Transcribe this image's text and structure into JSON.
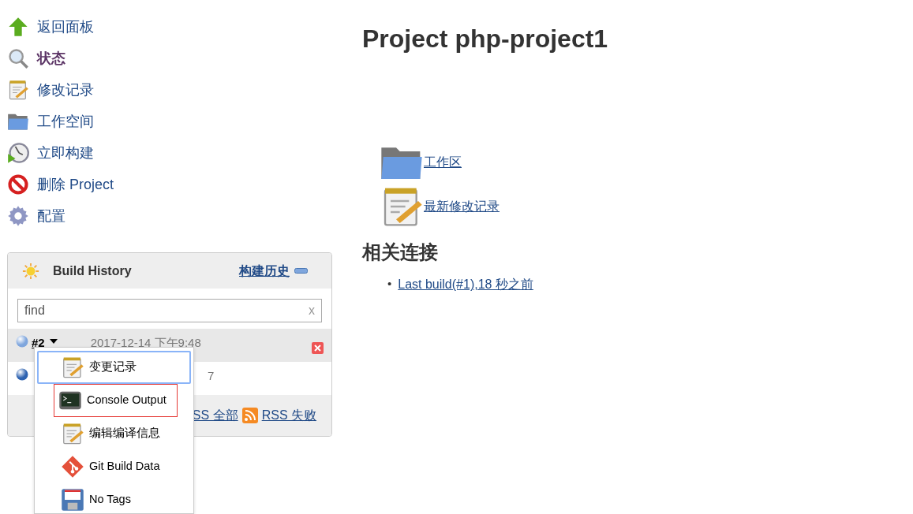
{
  "sidebar": {
    "items": [
      {
        "label": "返回面板",
        "kind": "up",
        "selected": false
      },
      {
        "label": "状态",
        "kind": "search",
        "selected": true
      },
      {
        "label": "修改记录",
        "kind": "notepad",
        "selected": false
      },
      {
        "label": "工作空间",
        "kind": "folder",
        "selected": false
      },
      {
        "label": "立即构建",
        "kind": "clock",
        "selected": false
      },
      {
        "label": "删除 Project",
        "kind": "forbid",
        "selected": false
      },
      {
        "label": "配置",
        "kind": "gear",
        "selected": false
      }
    ]
  },
  "build_history": {
    "title": "Build History",
    "trend_link": "构建历史",
    "search": {
      "placeholder": "find",
      "clear": "x"
    },
    "builds": [
      {
        "number": "#2",
        "time": "2017-12-14 下午9:48",
        "selected": true
      },
      {
        "time": "7",
        "selected": false
      }
    ],
    "footer_links": [
      {
        "label": "SS 全部",
        "kind": "plain"
      },
      {
        "label": "RSS 失败",
        "kind": "rss"
      }
    ]
  },
  "menu": {
    "items": [
      {
        "label": "变更记录",
        "kind": "notepad",
        "focused": true,
        "outlined": false
      },
      {
        "label": "Console Output",
        "kind": "terminal",
        "focused": false,
        "outlined": true
      },
      {
        "label": "编辑编译信息",
        "kind": "notepad",
        "focused": false,
        "outlined": false
      },
      {
        "label": "Git Build Data",
        "kind": "git",
        "focused": false,
        "outlined": false
      },
      {
        "label": "No Tags",
        "kind": "disk",
        "focused": false,
        "outlined": false
      }
    ]
  },
  "main": {
    "title": "Project php-project1",
    "links": [
      {
        "label": "工作区",
        "kind": "folder"
      },
      {
        "label": "最新修改记录",
        "kind": "notepad"
      }
    ],
    "related_heading": "相关连接",
    "related": [
      {
        "marker": "•",
        "label": "Last build(#1),18 秒之前"
      }
    ]
  }
}
